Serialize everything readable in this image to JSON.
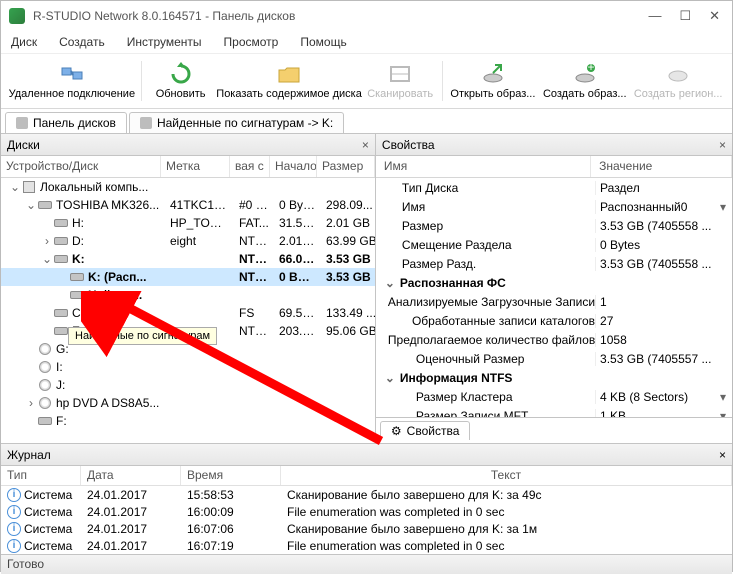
{
  "window": {
    "title": "R-STUDIO Network 8.0.164571 - Панель дисков"
  },
  "menu": {
    "items": [
      "Диск",
      "Создать",
      "Инструменты",
      "Просмотр",
      "Помощь"
    ]
  },
  "toolbar": {
    "remote": "Удаленное подключение",
    "refresh": "Обновить",
    "show": "Показать содержимое диска",
    "scan": "Сканировать",
    "openimg": "Открыть образ...",
    "createimg": "Создать образ...",
    "region": "Создать регион..."
  },
  "tabs": {
    "panel": "Панель дисков",
    "sig": "Найденные по сигнатурам -> K:"
  },
  "left": {
    "title": "Диски",
    "cols": {
      "dev": "Устройство/Диск",
      "label": "Метка",
      "fs": "вая с",
      "start": "Начало",
      "size": "Размер"
    },
    "rows": [
      {
        "depth": 0,
        "exp": "open",
        "icon": "pc",
        "dev": "Локальный компь..."
      },
      {
        "depth": 1,
        "exp": "open",
        "icon": "hdd",
        "dev": "TOSHIBA MK326...",
        "label": "41TKC1VIT",
        "fs": "#0 S...",
        "start": "0 Bytes",
        "size": "298.09..."
      },
      {
        "depth": 2,
        "icon": "hdd",
        "dev": "H:",
        "label": "HP_TOOLS",
        "fs": "FAT...",
        "start": "31.50 ...",
        "size": "2.01 GB"
      },
      {
        "depth": 2,
        "exp": "closed",
        "icon": "hdd",
        "dev": "D:",
        "label": "eight",
        "fs": "NTFS",
        "start": "2.01 GB",
        "size": "63.99 GB"
      },
      {
        "depth": 2,
        "exp": "open",
        "icon": "hdd",
        "dev": "K:",
        "fs": "NTFS",
        "start": "66.01...",
        "size": "3.53 GB",
        "bold": true
      },
      {
        "depth": 3,
        "icon": "hdd",
        "dev": "K: (Расп...",
        "fs": "NTFS",
        "start": "0 Bytes",
        "size": "3.53 GB",
        "selected": true,
        "bold": true
      },
      {
        "depth": 3,
        "icon": "hdd",
        "dev": "Найден...",
        "bold": true
      },
      {
        "depth": 2,
        "icon": "hdd",
        "dev": "C:",
        "fs": "FS",
        "start": "69.54 ...",
        "size": "133.49 ..."
      },
      {
        "depth": 2,
        "icon": "hdd",
        "dev": "E:",
        "fs": "NTFS",
        "start": "203.03...",
        "size": "95.06 GB"
      },
      {
        "depth": 1,
        "icon": "cd",
        "dev": "G:"
      },
      {
        "depth": 1,
        "icon": "cd",
        "dev": "I:"
      },
      {
        "depth": 1,
        "icon": "cd",
        "dev": "J:"
      },
      {
        "depth": 1,
        "exp": "closed",
        "icon": "cd",
        "dev": "hp DVD A DS8A5..."
      },
      {
        "depth": 1,
        "icon": "hdd",
        "dev": "F:"
      }
    ],
    "tooltip": "Найденные по сигнатурам"
  },
  "right": {
    "title": "Свойства",
    "cols": {
      "name": "Имя",
      "val": "Значение"
    },
    "rows": [
      {
        "indent": 1,
        "name": "Тип Диска",
        "val": "Раздел"
      },
      {
        "indent": 1,
        "name": "Имя",
        "val": "Распознанный0",
        "dd": true
      },
      {
        "indent": 1,
        "name": "Размер",
        "val": "3.53 GB (7405558 ..."
      },
      {
        "indent": 1,
        "name": "Смещение Раздела",
        "val": "0 Bytes"
      },
      {
        "indent": 1,
        "name": "Размер Разд.",
        "val": "3.53 GB (7405558 ..."
      },
      {
        "group": true,
        "toggler": "open",
        "name": "Распознанная ФС"
      },
      {
        "indent": 2,
        "name": "Анализируемые Загрузочные Записи",
        "val": "1"
      },
      {
        "indent": 2,
        "name": "Обработанные записи каталогов",
        "val": "27"
      },
      {
        "indent": 2,
        "name": "Предполагаемое количество файлов",
        "val": "1058"
      },
      {
        "indent": 2,
        "name": "Оценочный Размер",
        "val": "3.53 GB (7405557 ..."
      },
      {
        "group": true,
        "toggler": "open",
        "name": "Информация NTFS"
      },
      {
        "indent": 2,
        "name": "Размер Кластера",
        "val": "4 KB (8 Sectors)",
        "dd": true
      },
      {
        "indent": 2,
        "name": "Размер Записи MFT",
        "val": "1 KB",
        "dd": true
      }
    ],
    "tab": "Свойства"
  },
  "journal": {
    "title": "Журнал",
    "cols": {
      "type": "Тип",
      "date": "Дата",
      "time": "Время",
      "text": "Текст"
    },
    "rows": [
      {
        "type": "Система",
        "date": "24.01.2017",
        "time": "15:58:53",
        "text": "Сканирование было завершено для K: за 49с"
      },
      {
        "type": "Система",
        "date": "24.01.2017",
        "time": "16:00:09",
        "text": "File enumeration was completed in 0 sec"
      },
      {
        "type": "Система",
        "date": "24.01.2017",
        "time": "16:07:06",
        "text": "Сканирование было завершено для K: за 1м"
      },
      {
        "type": "Система",
        "date": "24.01.2017",
        "time": "16:07:19",
        "text": "File enumeration was completed in 0 sec"
      }
    ]
  },
  "status": "Готово"
}
